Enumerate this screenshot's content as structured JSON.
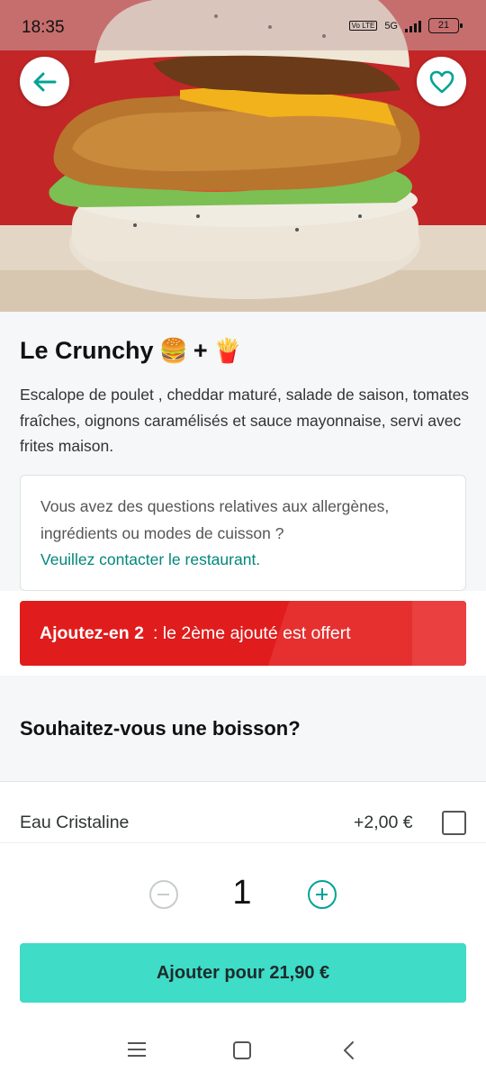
{
  "status_bar": {
    "time": "18:35",
    "network_volte": "Vo LTE",
    "network_type": "5G",
    "battery": "21"
  },
  "header": {
    "back_icon": "arrow-left-icon",
    "favorite_icon": "heart-outline-icon",
    "accent_color": "#00a394"
  },
  "product": {
    "name": "Le Crunchy",
    "emoji_1": "🍔",
    "plus": "+",
    "emoji_2": "🍟",
    "description": "Escalope de poulet , cheddar maturé, salade de saison, tomates fraîches, oignons caramélisés et sauce mayonnaise, servi avec frites maison."
  },
  "allergy_notice": {
    "text": "Vous avez des questions relatives aux allergènes, ingrédients ou modes de cuisson ?",
    "link": "Veuillez contacter le restaurant."
  },
  "promo": {
    "highlight": "Ajoutez-en 2",
    "text": ": le 2ème ajouté est offert",
    "color": "#e01c1c"
  },
  "drink_section": {
    "title": "Souhaitez-vous une boisson?",
    "options": [
      {
        "name": "Eau Cristaline",
        "price": "+2,00 €",
        "checked": false
      }
    ]
  },
  "quantity": {
    "value": "1",
    "minus_icon": "minus-circle-icon",
    "plus_icon": "plus-circle-icon"
  },
  "cta": {
    "label": "Ajouter pour 21,90 €",
    "color": "#3fdcc7"
  },
  "system_nav": {
    "menu_icon": "menu-icon",
    "home_icon": "home-square-icon",
    "back_icon": "chevron-left-icon"
  }
}
